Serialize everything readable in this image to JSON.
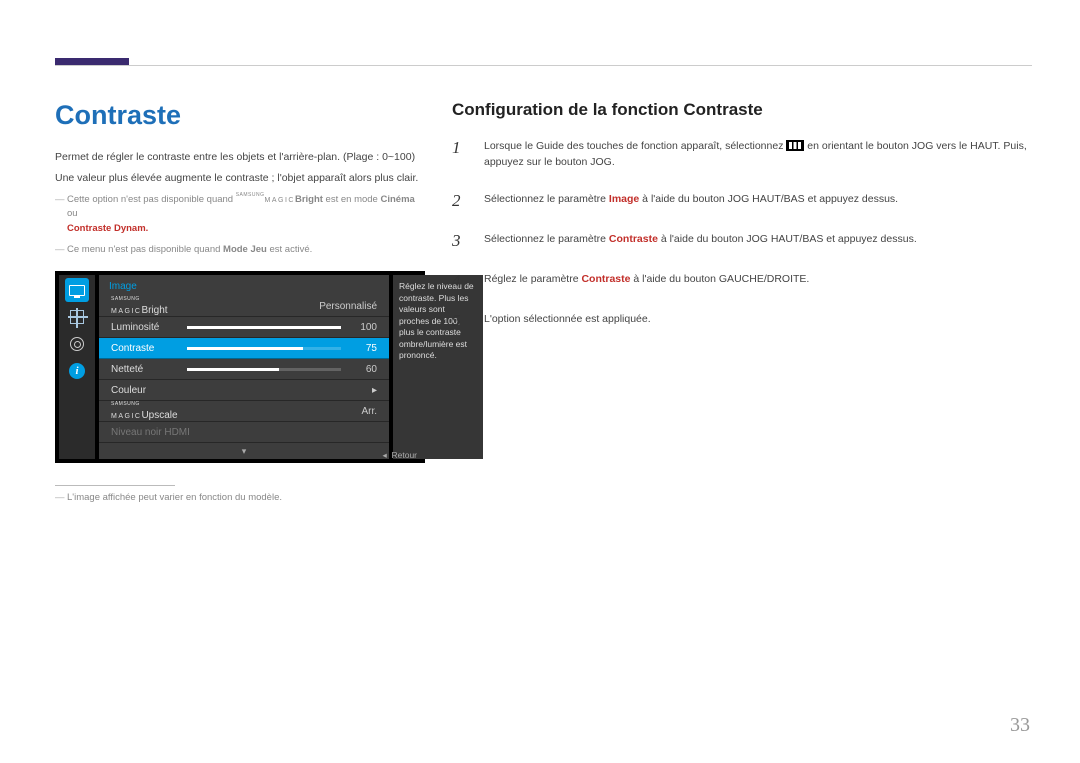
{
  "page_number": "33",
  "left": {
    "title": "Contraste",
    "desc1": "Permet de régler le contraste entre les objets et l'arrière-plan. (Plage : 0~100)",
    "desc2": "Une valeur plus élevée augmente le contraste ; l'objet apparaît alors plus clair.",
    "note1_a": "Cette option n'est pas disponible quand ",
    "note1_b": "Bright",
    "note1_c": " est en mode ",
    "note1_d": "Cinéma",
    "note1_e": " ou ",
    "dynam": "Contraste Dynam.",
    "note2_a": "Ce menu n'est pas disponible quand ",
    "note2_b": "Mode Jeu",
    "note2_c": " est activé.",
    "caption": "L'image affichée peut varier en fonction du modèle."
  },
  "osd": {
    "header": "Image",
    "rows": {
      "bright": {
        "label": "Bright",
        "value": "Personnalisé"
      },
      "lum": {
        "label": "Luminosité",
        "value": "100",
        "pct": 100
      },
      "contr": {
        "label": "Contraste",
        "value": "75",
        "pct": 75
      },
      "net": {
        "label": "Netteté",
        "value": "60",
        "pct": 60
      },
      "coul": {
        "label": "Couleur",
        "value": "▸"
      },
      "upsc": {
        "label": "Upscale",
        "value": "Arr."
      },
      "hdmi": {
        "label": "Niveau noir HDMI",
        "value": ""
      }
    },
    "desc": "Réglez le niveau de contraste. Plus les valeurs sont proches de 100, plus le contraste ombre/lumière est prononcé.",
    "footer_caret": "◂",
    "footer": "Retour",
    "samsung": "SAMSUNG",
    "magic": "MAGIC"
  },
  "right": {
    "subtitle": "Configuration de la fonction Contraste",
    "steps": {
      "s1_a": "Lorsque le Guide des touches de fonction apparaît, sélectionnez ",
      "s1_b": " en orientant le bouton JOG vers le HAUT. Puis, appuyez sur le bouton JOG.",
      "s2_a": "Sélectionnez le paramètre ",
      "s2_b": "Image",
      "s2_c": " à l'aide du bouton JOG HAUT/BAS et appuyez dessus.",
      "s3_a": "Sélectionnez le paramètre ",
      "s3_b": "Contraste",
      "s3_c": " à l'aide du bouton JOG HAUT/BAS et appuyez dessus.",
      "s4_a": "Réglez le paramètre ",
      "s4_b": "Contraste",
      "s4_c": " à l'aide du bouton GAUCHE/DROITE.",
      "s5": "L'option sélectionnée est appliquée."
    }
  }
}
